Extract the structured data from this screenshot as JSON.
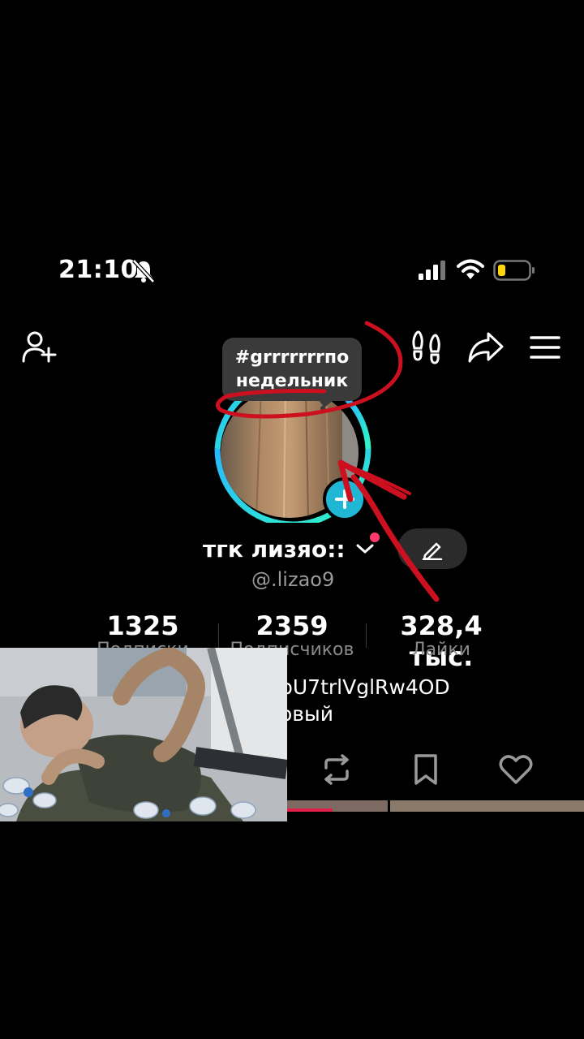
{
  "status_bar": {
    "time": "21:10",
    "icons": [
      "bell-muted-icon",
      "signal-icon",
      "wifi-icon",
      "battery-low-icon"
    ]
  },
  "top_bar": {
    "icons": [
      "add-friend-icon",
      "footprints-icon",
      "share-icon",
      "menu-icon"
    ]
  },
  "story_note": {
    "line1": "#grrrrrrrпо",
    "line2": "недельник"
  },
  "profile": {
    "name": "тгк лизяо::",
    "handle": "@.lizao9",
    "edit_icon": "pencil-icon"
  },
  "stats": [
    {
      "value": "1325",
      "label": "Подписки"
    },
    {
      "value": "2359",
      "label": "Подписчиков"
    },
    {
      "value": "328,4 тыс.",
      "label": "Лайки"
    }
  ],
  "bio": {
    "line1": "pU7trlVglRw4OD",
    "line2": "овый"
  },
  "tabs": [
    "repost-icon",
    "bookmark-icon",
    "heart-icon"
  ],
  "colors": {
    "ring_start": "#28b7ff",
    "ring_end": "#2ff5c5",
    "badge": "#20b7d4",
    "annotation": "#cc1020",
    "dot": "#ff3b6b"
  }
}
